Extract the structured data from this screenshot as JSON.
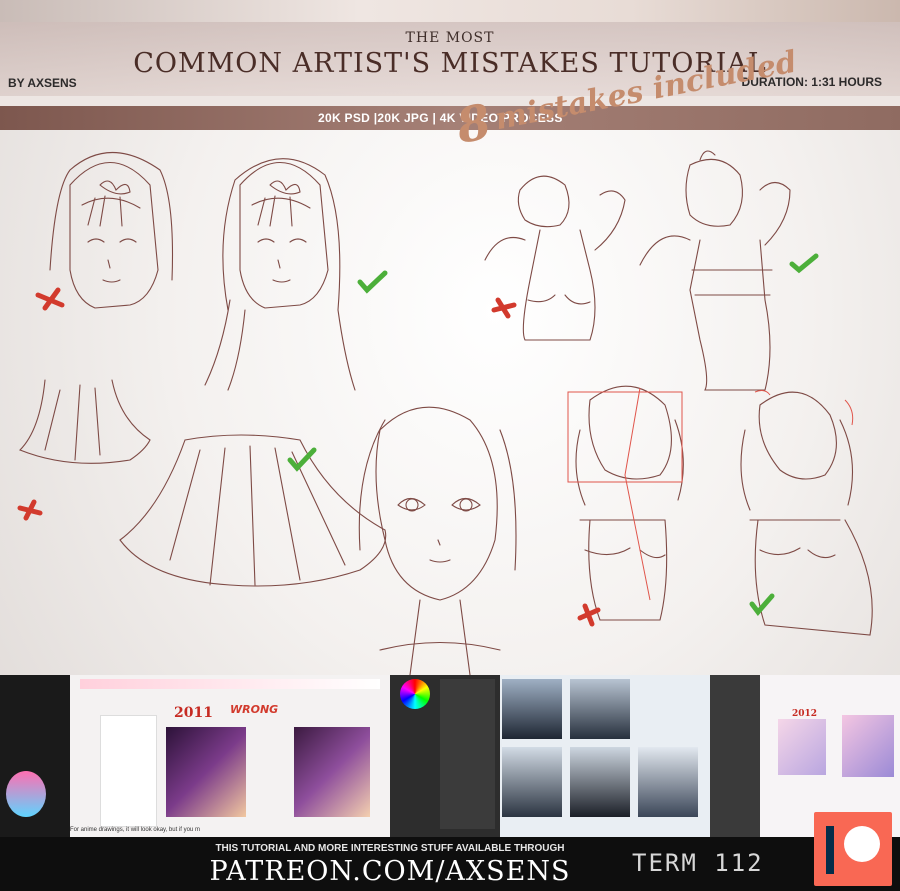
{
  "header": {
    "subtitle": "THE MOST",
    "title": "COMMON ARTIST'S MISTAKES TUTORIAL",
    "author": "BY AXSENS",
    "duration": "DURATION: 1:31 HOURS",
    "deliverables": "20K PSD  |20K JPG  |  4K  VIDEO PROCESS",
    "mistakes_number": "8",
    "mistakes_text": "mistakes included"
  },
  "screens": {
    "year_left": "2011",
    "wrong_label": "WRONG",
    "year_right": "2012",
    "caption": "For anime drawings, it will look okay, but if you m"
  },
  "footer": {
    "line1": "THIS TUTORIAL AND MORE INTERESTING STUFF AVAILABLE THROUGH",
    "url": "PATREON.COM/AXSENS",
    "term": "TERM 112"
  },
  "colors": {
    "accent": "#c58c6d",
    "bar": "#8f6b61",
    "wrong": "#d23a2d",
    "right": "#4caf3a",
    "patreon": "#f96854"
  }
}
